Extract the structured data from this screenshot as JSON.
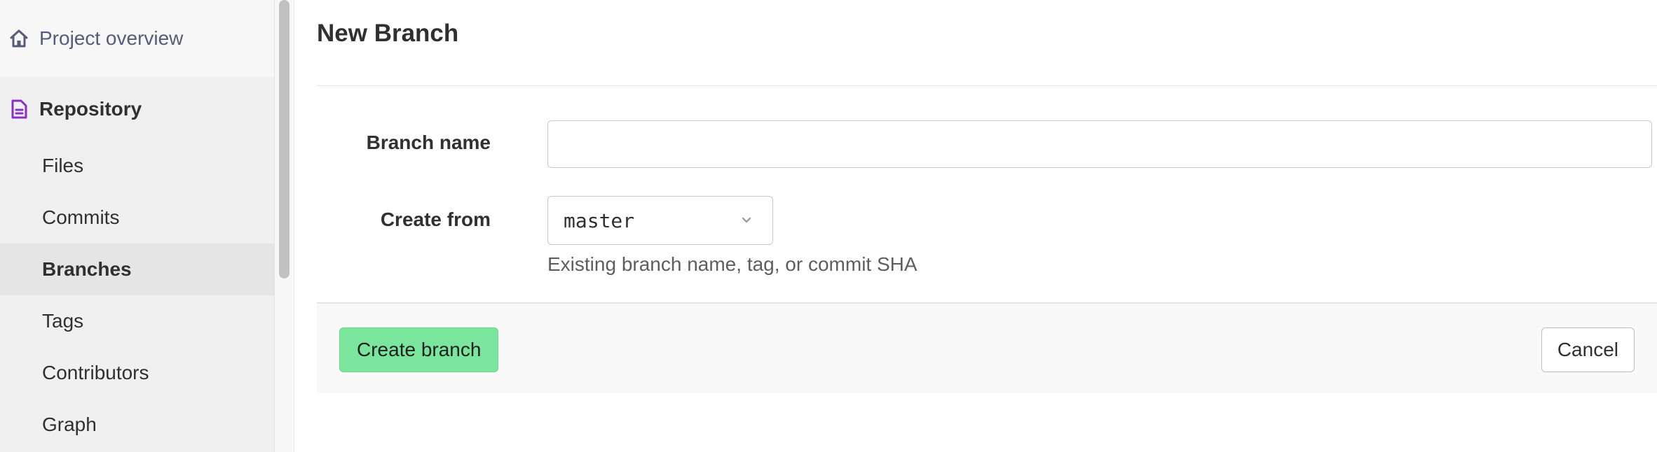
{
  "sidebar": {
    "project_overview": {
      "label": "Project overview",
      "icon": "home-icon"
    },
    "repository": {
      "label": "Repository",
      "icon": "repository-icon",
      "accent": "#8b2fc9"
    },
    "items": [
      {
        "label": "Files"
      },
      {
        "label": "Commits"
      },
      {
        "label": "Branches",
        "active": true
      },
      {
        "label": "Tags"
      },
      {
        "label": "Contributors"
      },
      {
        "label": "Graph"
      }
    ]
  },
  "main": {
    "title": "New Branch",
    "form": {
      "branch_name_label": "Branch name",
      "branch_name_value": "",
      "create_from_label": "Create from",
      "create_from_value": "master",
      "create_from_help": "Existing branch name, tag, or commit SHA"
    },
    "actions": {
      "create_label": "Create branch",
      "cancel_label": "Cancel"
    }
  },
  "colors": {
    "create_button": "#7ae59d",
    "repository_icon": "#8b2fc9",
    "sidebar_bg": "#f0f0f0",
    "active_item_bg": "#e5e5e5"
  }
}
